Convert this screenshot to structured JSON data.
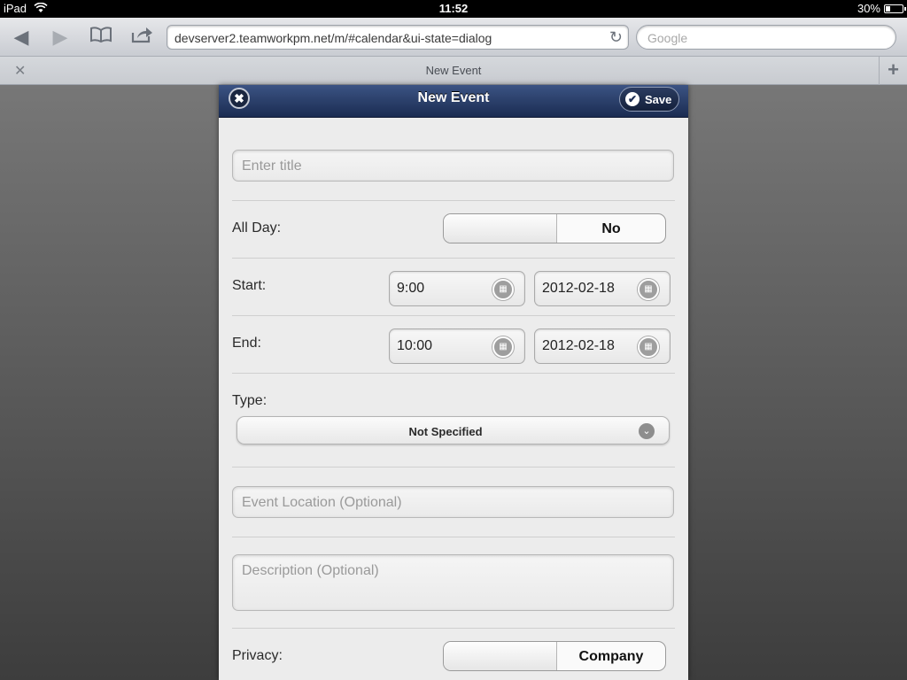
{
  "status": {
    "device": "iPad",
    "time": "11:52",
    "battery": "30%",
    "battery_level": 0.3
  },
  "browser": {
    "url": "devserver2.teamworkpm.net/m/#calendar&ui-state=dialog",
    "search_placeholder": "Google",
    "tab_title": "New Event"
  },
  "dialog": {
    "title": "New Event",
    "save_label": "Save",
    "title_placeholder": "Enter title",
    "all_day": {
      "label": "All Day:",
      "value": "No"
    },
    "start": {
      "label": "Start:",
      "time": "9:00",
      "date": "2012-02-18"
    },
    "end": {
      "label": "End:",
      "time": "10:00",
      "date": "2012-02-18"
    },
    "type": {
      "label": "Type:",
      "value": "Not Specified"
    },
    "location_placeholder": "Event Location (Optional)",
    "description_placeholder": "Description (Optional)",
    "privacy": {
      "label": "Privacy:",
      "value": "Company"
    }
  }
}
